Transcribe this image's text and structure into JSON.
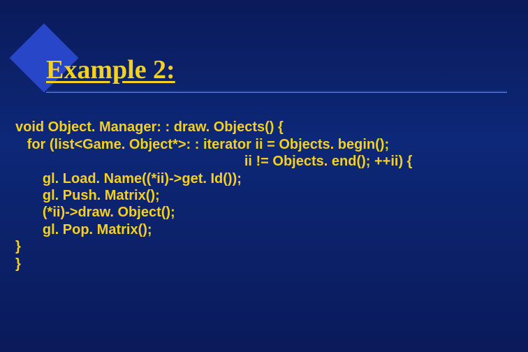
{
  "slide": {
    "title": "Example 2:",
    "code": {
      "l1": "void Object. Manager: : draw. Objects() {",
      "l2": "   for (list<Game. Object*>: : iterator ii = Objects. begin();",
      "l3": "                                                           ii != Objects. end(); ++ii) {",
      "l4": "       gl. Load. Name((*ii)->get. Id());",
      "l5": "       gl. Push. Matrix();",
      "l6": "       (*ii)->draw. Object();",
      "l7": "       gl. Pop. Matrix();",
      "l8": "}",
      "l9": "}"
    }
  }
}
